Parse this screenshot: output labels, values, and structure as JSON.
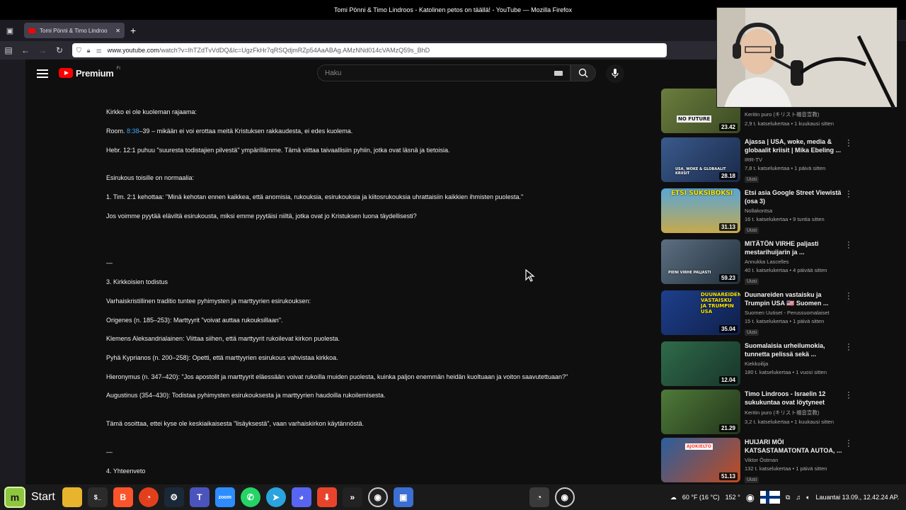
{
  "window": {
    "title": "Tomi Pönni & Timo Lindroos - Katolinen petos on täällä! - YouTube — Mozilla Firefox"
  },
  "browser": {
    "tab_title": "Tomi Pönni & Timo Lindroo",
    "url_host": "www.youtube.com",
    "url_rest": "/watch?v=IhTZdTvVdDQ&lc=UgzFkHr7qRSQdjmRZp54AaABAg.AMzNNd014cVAMzQ59s_BhD"
  },
  "youtube": {
    "logo_word": "Premium",
    "country_code": "FI",
    "search_placeholder": "Haku"
  },
  "description": {
    "lines": [
      "Kirkko ei ole kuoleman rajaama:",
      "Room. ",
      "Hebr. 12:1 puhuu \"suuresta todistajien pilvestä\" ympärillämme. Tämä viittaa taivaallisiin pyhiin, jotka ovat läsnä ja tietoisia.",
      "Esirukous toisille on normaalia:",
      "1. Tim. 2:1 kehottaa: \"Minä kehotan ennen kaikkea, että anomisia, rukouksia, esirukouksia ja kiitosrukouksia uhrattaisiin kaikkien ihmisten puolesta.\"",
      "Jos voimme pyytää eläviltä esirukousta, miksi emme pyytäisi niiltä, jotka ovat jo Kristuksen luona täydellisesti?",
      "—",
      "3. Kirkkoisien todistus",
      "Varhaiskristillinen traditio tuntee pyhimysten ja marttyyrien esirukouksen:",
      "Origenes (n. 185–253): Marttyyrit \"voivat auttaa rukouksillaan\".",
      "Klemens Aleksandrialainen: Viittaa siihen, että marttyyrit rukoilevat kirkon puolesta.",
      "Pyhä Kyprianos (n. 200–258): Opetti, että marttyyrien esirukous vahvistaa kirkkoa.",
      "Hieronymus (n. 347–420): \"Jos apostolit ja marttyyrit eläessään voivat rukoilla muiden puolesta, kuinka paljon enemmän heidän kuoltuaan ja voiton saavutettuaan?\"",
      "Augustinus (354–430): Todistaa pyhimysten esirukouksesta ja marttyyrien haudoilla rukoilemisesta.",
      "Tämä osoittaa, ettei kyse ole keskiaikaisesta \"lisäyksestä\", vaan varhaiskirkon käytännöstä.",
      "—",
      "4. Yhteenveto"
    ],
    "romans_link": "8:38",
    "romans_rest": "–39 – mikään ei voi erottaa meitä Kristuksen rakkaudesta, ei edes kuolema."
  },
  "recommendations": [
    {
      "title": "",
      "channel": "Keritin puro (キリスト福音宣教)",
      "meta": "2,9 t. katselukertaa • 1 kuukausi sitten",
      "duration": "23.42",
      "badge": "",
      "thumb_text": "NO FUTURE",
      "color": "#6b7d3e"
    },
    {
      "title": "Ajassa | USA, woke, media & globaalit kriisit | Mika Ebeling ...",
      "channel": "IRR-TV",
      "meta": "7,8 t. katselukertaa • 1 päivä sitten",
      "duration": "28.18",
      "badge": "Uusi",
      "thumb_text": "USA, WOKE & GLOBAALIT KRIISIT",
      "color": "#3a5a8c"
    },
    {
      "title": "Etsi asia Google Street Viewistä (osa 3)",
      "channel": "Nollakontsa",
      "meta": "16 t. katselukertaa • 9 tuntia sitten",
      "duration": "31.13",
      "badge": "Uusi",
      "thumb_text": "ETSI SUKSIBOKSI",
      "color": "#58a6d8"
    },
    {
      "title": "MITÄTÖN VIRHE paljasti mestarihuijarin ja ...",
      "channel": "Annukka Lascelles",
      "meta": "40 t. katselukertaa • 4 päivää sitten",
      "duration": "59.23",
      "badge": "Uusi",
      "thumb_text": "PIENI VIRHE PALJASTI",
      "color": "#5c6f82"
    },
    {
      "title": "Duunareiden vastaisku ja Trumpin USA 🇺🇸 Suomen ...",
      "channel": "Suomen Uutiset - Perussuomalaiset",
      "meta": "15 t. katselukertaa • 1 päivä sitten",
      "duration": "35.04",
      "badge": "Uusi",
      "thumb_text": "DUUNAREIDEN VASTAISKU JA TRUMPIN USA",
      "color": "#1e3f8c"
    },
    {
      "title": "Suomalaisia urheilumokia, tunnetta pelissä sekä ...",
      "channel": "Kiekkoilija",
      "meta": "180 t. katselukertaa • 1 vuosi sitten",
      "duration": "12.04",
      "badge": "",
      "thumb_text": "",
      "color": "#2f6b4a"
    },
    {
      "title": "Timo Lindroos - Israelin 12 sukukuntaa ovat löytyneet",
      "channel": "Keritin puro (キリスト福音宣教)",
      "meta": "3,2 t. katselukertaa • 1 kuukausi sitten",
      "duration": "21.29",
      "badge": "",
      "thumb_text": "",
      "color": "#4f7a3a"
    },
    {
      "title": "HUIJARI MÖI KATSASTAMATONTA AUTOA, ...",
      "channel": "Viktor Östman",
      "meta": "132 t. katselukertaa • 1 päivä sitten",
      "duration": "51.13",
      "badge": "Uusi",
      "thumb_text": "AJOKIELTO",
      "color": "#2a5f9e"
    }
  ],
  "taskbar": {
    "start_label": "Start",
    "weather": "60 °F (16 °C)",
    "degree": "152 °",
    "clock": "Lauantai 13.09., 12.42.24 AP."
  }
}
